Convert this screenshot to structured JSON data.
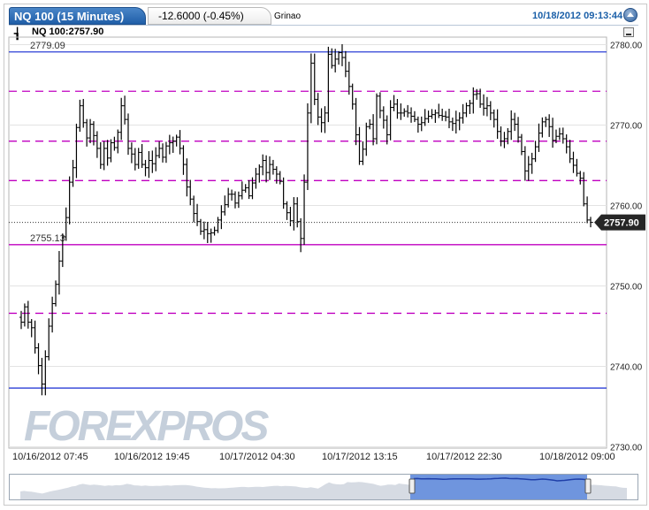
{
  "header": {
    "tab_title": "NQ 100 (15 Minutes)",
    "change": "-12.6000 (-0.45%)",
    "tab3": "Grinao",
    "datetime": "10/18/2012 09:13:44",
    "symbol_value": "NQ 100:2757.90"
  },
  "watermark": "FOREXPROS",
  "colors": {
    "accent": "#1f5ea8",
    "blue_line": "#2b3fd6",
    "magenta": "#c000c0",
    "candle": "#000000",
    "nav_fill": "#6f95de"
  },
  "chart_data": {
    "type": "line",
    "title": "NQ 100 (15 Minutes)",
    "xlabel": "",
    "ylabel": "",
    "ylim": [
      2730,
      2781
    ],
    "y_ticks": [
      2780,
      2770,
      2760,
      2750,
      2740,
      2730
    ],
    "y_tick_labels": [
      "2780.00",
      "2770.00",
      "2760.00",
      "2750.00",
      "2740.00",
      "2730.00"
    ],
    "x_tick_labels": [
      "10/16/2012 07:45",
      "10/16/2012 19:45",
      "10/17/2012 04:30",
      "10/17/2012 13:15",
      "10/17/2012 22:30",
      "10/18/2012 09:00"
    ],
    "last_price": 2757.9,
    "last_price_label": "2757.90",
    "grid": true,
    "levels": [
      {
        "value": 2779.09,
        "style": "solid",
        "color": "#2b3fd6",
        "label": "2779.09"
      },
      {
        "value": 2774.2,
        "style": "dashed",
        "color": "#c000c0"
      },
      {
        "value": 2768.0,
        "style": "dashed",
        "color": "#c000c0"
      },
      {
        "value": 2763.1,
        "style": "dashed",
        "color": "#c000c0"
      },
      {
        "value": 2755.13,
        "style": "solid",
        "color": "#c000c0",
        "label": "2755.13"
      },
      {
        "value": 2746.6,
        "style": "dashed",
        "color": "#c000c0"
      },
      {
        "value": 2737.3,
        "style": "solid",
        "color": "#2b3fd6"
      }
    ],
    "series": [
      {
        "values": [
          2745.5,
          2747.4,
          2745.5,
          2744.8,
          2742.3,
          2740.1,
          2737.8,
          2741.2,
          2745.0,
          2747.8,
          2750.2,
          2753.1,
          2756.1,
          2758.5,
          2762.9,
          2764.7,
          2769.7,
          2772.4,
          2770.3,
          2768.4,
          2770.1,
          2768.7,
          2767.1,
          2765.1,
          2767.1,
          2765.9,
          2767.8,
          2767.2,
          2769.1,
          2772.4,
          2770.7,
          2767.1,
          2766.4,
          2765.1,
          2766.6,
          2765.1,
          2764.7,
          2765.6,
          2765.2,
          2766.2,
          2767.1,
          2766.0,
          2767.4,
          2767.8,
          2768.0,
          2768.5,
          2767.1,
          2765.1,
          2762.3,
          2760.8,
          2759.0,
          2758.0,
          2756.8,
          2757.0,
          2756.5,
          2756.6,
          2756.9,
          2758.2,
          2759.2,
          2760.1,
          2761.4,
          2761.4,
          2760.3,
          2761.2,
          2761.9,
          2762.2,
          2761.2,
          2762.8,
          2763.9,
          2764.8,
          2765.6,
          2764.1,
          2765.1,
          2764.5,
          2763.9,
          2763.0,
          2760.2,
          2759.1,
          2758.1,
          2760.2,
          2758.0,
          2755.9,
          2762.9,
          2771.5,
          2777.7,
          2773.2,
          2771.0,
          2770.3,
          2771.5,
          2778.8,
          2777.4,
          2778.2,
          2779.0,
          2778.4,
          2776.7,
          2774.8,
          2772.6,
          2768.8,
          2765.5,
          2767.0,
          2769.8,
          2770.1,
          2768.3,
          2773.6,
          2771.8,
          2770.6,
          2768.8,
          2772.2,
          2772.6,
          2771.5,
          2771.5,
          2771.7,
          2771.5,
          2771.1,
          2770.7,
          2770.1,
          2770.3,
          2770.8,
          2771.1,
          2771.3,
          2771.5,
          2771.2,
          2771.1,
          2771.0,
          2770.4,
          2770.2,
          2770.6,
          2770.9,
          2771.5,
          2772.4,
          2772.7,
          2773.8,
          2773.9,
          2772.6,
          2772.1,
          2772.4,
          2771.5,
          2770.7,
          2769.2,
          2768.0,
          2768.3,
          2769.2,
          2770.7,
          2770.1,
          2768.5,
          2766.7,
          2764.3,
          2765.1,
          2765.8,
          2767.3,
          2769.0,
          2770.4,
          2770.7,
          2769.8,
          2768.1,
          2768.6,
          2768.9,
          2768.3,
          2767.3,
          2765.8,
          2765.0,
          2764.0,
          2763.4,
          2760.2,
          2758.2,
          2757.9
        ]
      }
    ]
  }
}
